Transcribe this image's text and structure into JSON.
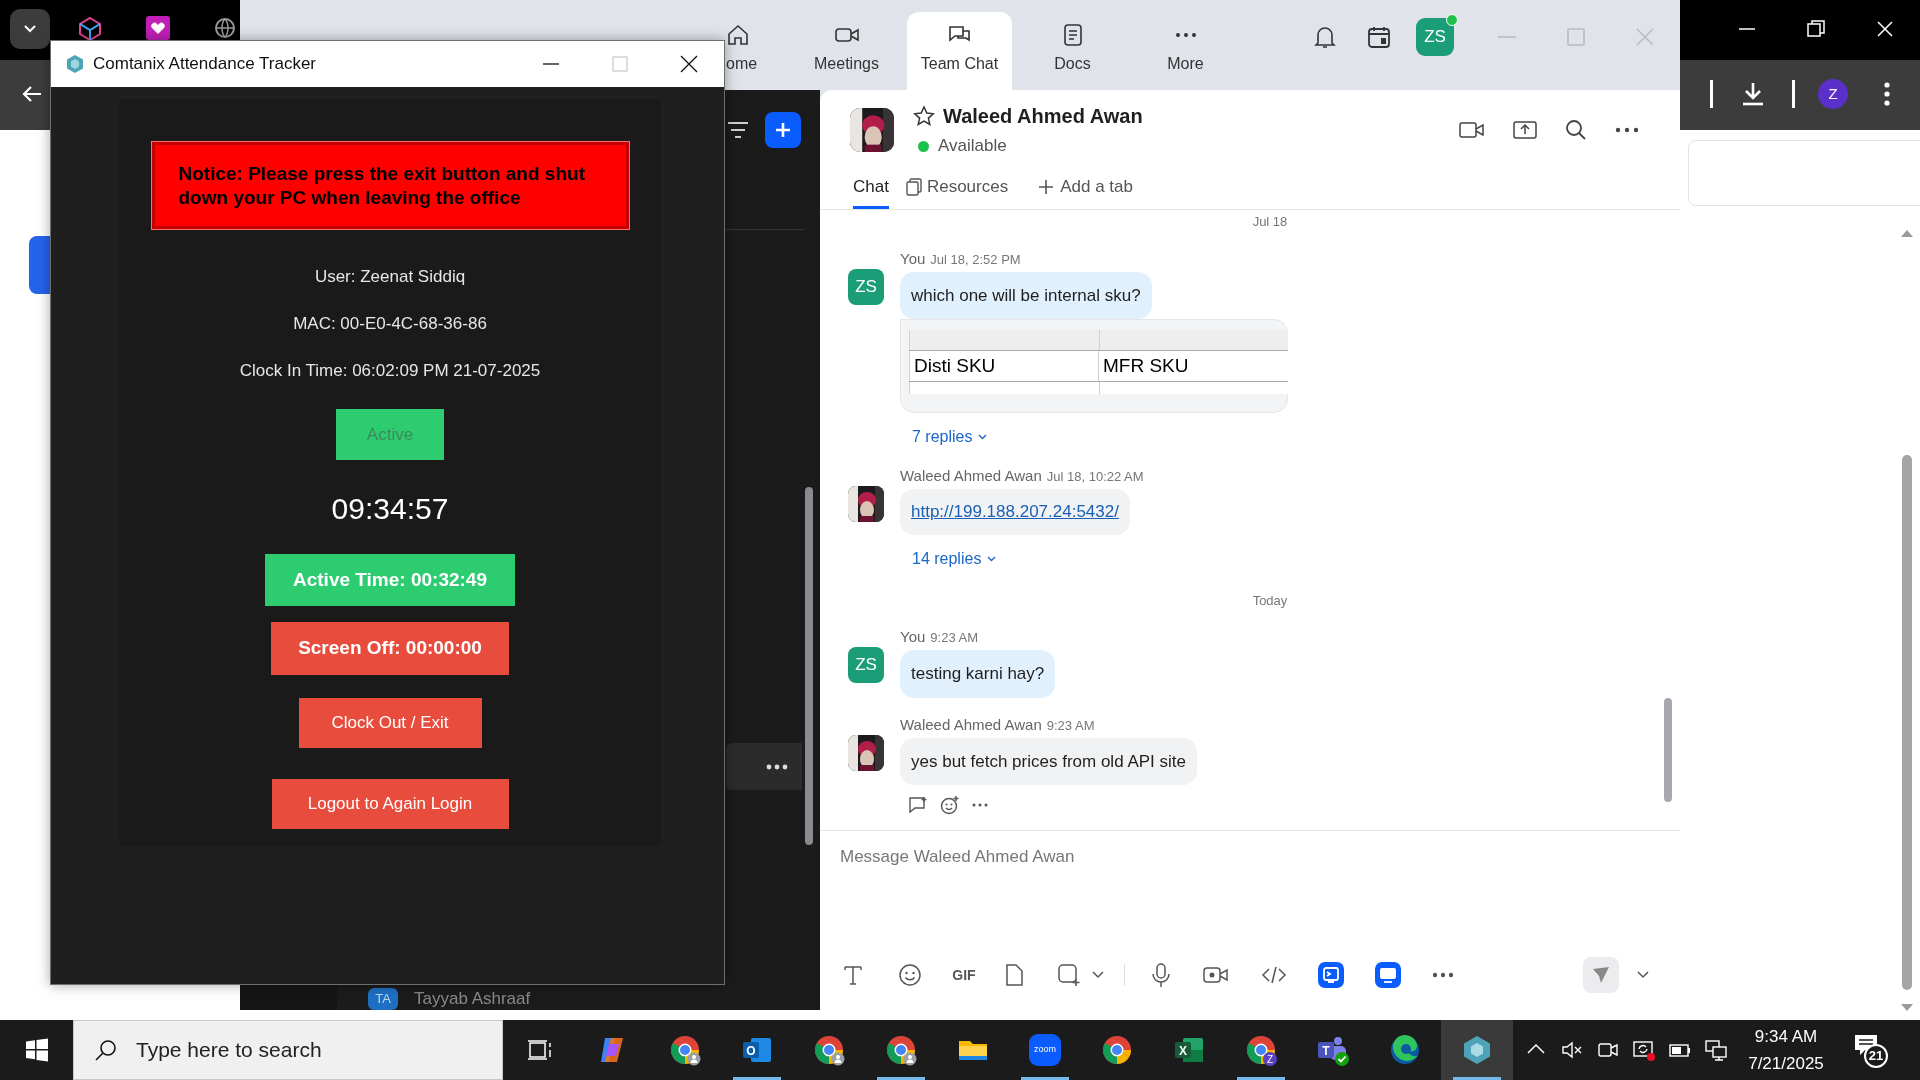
{
  "browser": {
    "profile_initial": "Z"
  },
  "zoom": {
    "nav": [
      {
        "label": "ome",
        "selected": false
      },
      {
        "label": "Meetings",
        "selected": false
      },
      {
        "label": "Team Chat",
        "selected": true
      },
      {
        "label": "Docs",
        "selected": false
      },
      {
        "label": "More",
        "selected": false
      }
    ],
    "profile_initials": "ZS",
    "sidebar_contact": {
      "initials": "TA",
      "name": "Tayyab Ashraaf"
    }
  },
  "chat": {
    "contact": "Waleed Ahmed Awan",
    "status": "Available",
    "tabs": [
      {
        "label": "Chat",
        "selected": true
      },
      {
        "label": "Resources",
        "selected": false
      }
    ],
    "add_tab": "Add a tab",
    "messages": [
      {
        "kind": "date",
        "text": "Jul 18"
      },
      {
        "kind": "message",
        "mine": true,
        "initials": "ZS",
        "sender": "You",
        "time": "Jul 18, 2:52 PM",
        "text": "which one will be internal sku?",
        "table": [
          "Disti SKU",
          "MFR SKU"
        ],
        "replies": "7 replies"
      },
      {
        "kind": "message",
        "mine": false,
        "sender": "Waleed Ahmed Awan",
        "time": "Jul 18, 10:22 AM",
        "link": "http://199.188.207.24:5432/",
        "replies": "14 replies"
      },
      {
        "kind": "date",
        "text": "Today"
      },
      {
        "kind": "message",
        "mine": true,
        "initials": "ZS",
        "sender": "You",
        "time": "9:23 AM",
        "text": "testing karni hay?"
      },
      {
        "kind": "message",
        "mine": false,
        "sender": "Waleed Ahmed Awan",
        "time": "9:23 AM",
        "text": "yes but fetch prices from old API site",
        "reactions": true
      }
    ],
    "composer": {
      "placeholder": "Message Waleed Ahmed Awan",
      "gif": "GIF"
    }
  },
  "tracker": {
    "title": "Comtanix Attendance Tracker",
    "notice": "Notice: Please press the exit button and shut down your PC when leaving the office",
    "info": [
      "User: Zeenat Siddiq",
      "MAC: 00-E0-4C-68-36-86",
      "Clock In Time: 06:02:09 PM 21-07-2025"
    ],
    "status": {
      "label": "Active",
      "disabled": true
    },
    "clock": "09:34:57",
    "active_time": "Active Time: 00:32:49",
    "screen_off": "Screen Off: 00:00:00",
    "buttons": [
      "Clock Out / Exit",
      "Logout to Again Login"
    ]
  },
  "taskbar": {
    "search_placeholder": "Type here to search",
    "apps": [
      {
        "kind": "copilot",
        "running": false
      },
      {
        "kind": "chrome",
        "badge": true,
        "running": false
      },
      {
        "kind": "outlook",
        "glyph": "O",
        "running": true
      },
      {
        "kind": "chrome",
        "badge": true,
        "running": false
      },
      {
        "kind": "chrome",
        "badge": true,
        "running": true
      },
      {
        "kind": "folder",
        "running": false
      },
      {
        "kind": "zoom",
        "glyph": "zoom",
        "running": true
      },
      {
        "kind": "chrome",
        "running": false
      },
      {
        "kind": "excel",
        "glyph": "X",
        "running": false
      },
      {
        "kind": "chrome",
        "badge": true,
        "badge_text": "Z",
        "running": true
      },
      {
        "kind": "teams",
        "glyph": "T",
        "running": false
      },
      {
        "kind": "edge",
        "running": false
      },
      {
        "kind": "tracker",
        "running": true
      }
    ],
    "time": "9:34 AM",
    "date": "7/21/2025",
    "notifications": "21"
  }
}
